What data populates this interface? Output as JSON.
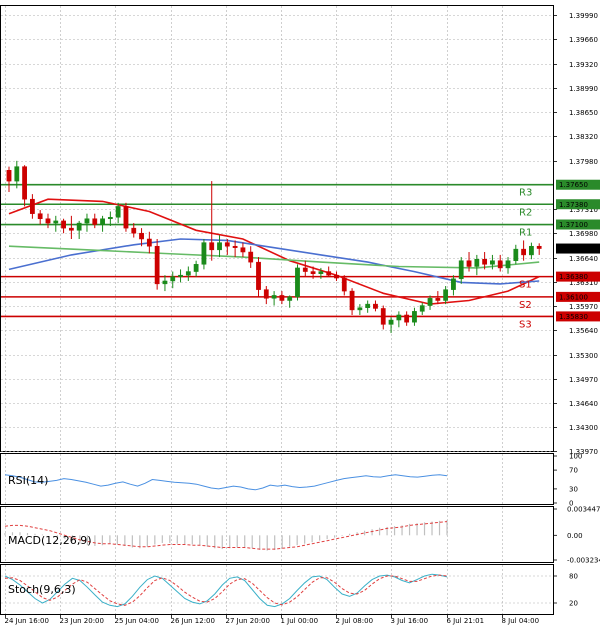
{
  "colors": {
    "up": "#1a8a1a",
    "down": "#cc0000",
    "ma_fast": "#e01010",
    "ma_mid": "#4a6fd0",
    "ma_slow": "#66bb66",
    "resistance": "#2a8a2a",
    "support": "#cc0000",
    "grid": "#b0b0b0",
    "rsi_line": "#4a90e2",
    "macd_hist": "#c0c0c0",
    "macd_signal": "#e04040",
    "stoch_main": "#3ab0c8",
    "stoch_signal": "#e04040"
  },
  "chart_data": [
    {
      "type": "candlestick",
      "x_labels": [
        "24 Jun 16:00",
        "23 Jun 20:00",
        "25 Jun 04:00",
        "26 Jun 12:00",
        "27 Jun 20:00",
        "1 Jul 00:00",
        "2 Jul 08:00",
        "3 Jul 16:00",
        "6 Jul 21:01",
        "8 Jul 04:00"
      ],
      "y_ticks": [
        "1.39990",
        "1.39660",
        "1.39320",
        "1.38990",
        "1.38650",
        "1.38320",
        "1.37980",
        "1.37310",
        "1.36980",
        "1.36640",
        "1.36310",
        "1.35970",
        "1.35640",
        "1.35300",
        "1.34970",
        "1.34640",
        "1.34300",
        "1.33970"
      ],
      "ylim": [
        1.3397,
        1.4012
      ],
      "candles": [
        [
          1.3785,
          1.379,
          1.3755,
          1.377
        ],
        [
          1.377,
          1.3798,
          1.376,
          1.379
        ],
        [
          1.379,
          1.3792,
          1.3735,
          1.3745
        ],
        [
          1.3745,
          1.3752,
          1.3718,
          1.3725
        ],
        [
          1.3725,
          1.373,
          1.371,
          1.3718
        ],
        [
          1.3718,
          1.3725,
          1.3705,
          1.3712
        ],
        [
          1.3712,
          1.3722,
          1.37,
          1.3715
        ],
        [
          1.3715,
          1.3718,
          1.3698,
          1.3705
        ],
        [
          1.3705,
          1.3722,
          1.369,
          1.3702
        ],
        [
          1.3702,
          1.3715,
          1.369,
          1.3712
        ],
        [
          1.3712,
          1.3725,
          1.37,
          1.3718
        ],
        [
          1.3718,
          1.3725,
          1.3705,
          1.371
        ],
        [
          1.371,
          1.3722,
          1.37,
          1.3718
        ],
        [
          1.3718,
          1.3728,
          1.3708,
          1.372
        ],
        [
          1.372,
          1.374,
          1.3712,
          1.3735
        ],
        [
          1.3735,
          1.374,
          1.37,
          1.3705
        ],
        [
          1.3705,
          1.3712,
          1.3692,
          1.3698
        ],
        [
          1.3698,
          1.3705,
          1.368,
          1.369
        ],
        [
          1.369,
          1.37,
          1.367,
          1.368
        ],
        [
          1.368,
          1.369,
          1.362,
          1.3628
        ],
        [
          1.3628,
          1.364,
          1.3618,
          1.3632
        ],
        [
          1.3632,
          1.3645,
          1.3622,
          1.3638
        ],
        [
          1.3638,
          1.3648,
          1.363,
          1.364
        ],
        [
          1.364,
          1.3652,
          1.3632,
          1.3645
        ],
        [
          1.3645,
          1.366,
          1.3638,
          1.3655
        ],
        [
          1.3655,
          1.369,
          1.3648,
          1.3685
        ],
        [
          1.3685,
          1.377,
          1.366,
          1.3675
        ],
        [
          1.3675,
          1.3695,
          1.3665,
          1.3685
        ],
        [
          1.3685,
          1.369,
          1.3668,
          1.368
        ],
        [
          1.368,
          1.3688,
          1.3665,
          1.3678
        ],
        [
          1.3678,
          1.3685,
          1.3665,
          1.3672
        ],
        [
          1.3672,
          1.368,
          1.365,
          1.3658
        ],
        [
          1.3658,
          1.3665,
          1.361,
          1.362
        ],
        [
          1.362,
          1.3625,
          1.36,
          1.3608
        ],
        [
          1.3608,
          1.3618,
          1.3598,
          1.3612
        ],
        [
          1.3612,
          1.3618,
          1.36,
          1.3605
        ],
        [
          1.3605,
          1.3612,
          1.3595,
          1.361
        ],
        [
          1.361,
          1.3655,
          1.3605,
          1.365
        ],
        [
          1.365,
          1.366,
          1.3638,
          1.3645
        ],
        [
          1.3645,
          1.3652,
          1.3635,
          1.3642
        ],
        [
          1.3642,
          1.365,
          1.3635,
          1.3645
        ],
        [
          1.3645,
          1.3652,
          1.3638,
          1.364
        ],
        [
          1.364,
          1.3645,
          1.3632,
          1.3636
        ],
        [
          1.3636,
          1.364,
          1.3612,
          1.3618
        ],
        [
          1.3618,
          1.3622,
          1.3585,
          1.3592
        ],
        [
          1.3592,
          1.36,
          1.3585,
          1.3595
        ],
        [
          1.3595,
          1.3605,
          1.3588,
          1.36
        ],
        [
          1.36,
          1.3605,
          1.359,
          1.3594
        ],
        [
          1.3594,
          1.3598,
          1.3565,
          1.3572
        ],
        [
          1.3572,
          1.3582,
          1.356,
          1.3578
        ],
        [
          1.3578,
          1.359,
          1.3568,
          1.3585
        ],
        [
          1.3585,
          1.359,
          1.357,
          1.3575
        ],
        [
          1.3575,
          1.3595,
          1.357,
          1.359
        ],
        [
          1.359,
          1.3602,
          1.3585,
          1.3598
        ],
        [
          1.3598,
          1.3612,
          1.3592,
          1.3608
        ],
        [
          1.3608,
          1.3618,
          1.36,
          1.3605
        ],
        [
          1.3605,
          1.3625,
          1.36,
          1.362
        ],
        [
          1.362,
          1.364,
          1.3612,
          1.3635
        ],
        [
          1.3635,
          1.3665,
          1.3628,
          1.366
        ],
        [
          1.366,
          1.3672,
          1.3645,
          1.3652
        ],
        [
          1.3652,
          1.3668,
          1.364,
          1.3662
        ],
        [
          1.3662,
          1.3672,
          1.3648,
          1.3655
        ],
        [
          1.3655,
          1.3668,
          1.3648,
          1.366
        ],
        [
          1.366,
          1.3668,
          1.3645,
          1.365
        ],
        [
          1.365,
          1.3665,
          1.3642,
          1.366
        ],
        [
          1.366,
          1.3682,
          1.3655,
          1.3676
        ],
        [
          1.3676,
          1.3688,
          1.366,
          1.3668
        ],
        [
          1.3668,
          1.3685,
          1.3662,
          1.368
        ],
        [
          1.368,
          1.3684,
          1.3668,
          1.36768
        ]
      ],
      "moving_averages": [
        {
          "values": [
            [
              0,
              1.3725
            ],
            [
              5,
              1.3745
            ],
            [
              12,
              1.3742
            ],
            [
              18,
              1.3728
            ],
            [
              24,
              1.3702
            ],
            [
              30,
              1.369
            ],
            [
              36,
              1.366
            ],
            [
              42,
              1.364
            ],
            [
              48,
              1.3615
            ],
            [
              54,
              1.36
            ],
            [
              59,
              1.3605
            ],
            [
              64,
              1.3618
            ],
            [
              68,
              1.3638
            ]
          ]
        },
        {
          "values": [
            [
              0,
              1.3648
            ],
            [
              8,
              1.3668
            ],
            [
              16,
              1.3682
            ],
            [
              22,
              1.369
            ],
            [
              28,
              1.3688
            ],
            [
              34,
              1.3678
            ],
            [
              40,
              1.3668
            ],
            [
              46,
              1.3658
            ],
            [
              52,
              1.3645
            ],
            [
              58,
              1.363
            ],
            [
              63,
              1.3628
            ],
            [
              68,
              1.3632
            ]
          ]
        },
        {
          "values": [
            [
              0,
              1.368
            ],
            [
              10,
              1.3675
            ],
            [
              20,
              1.367
            ],
            [
              30,
              1.3665
            ],
            [
              40,
              1.3658
            ],
            [
              50,
              1.3652
            ],
            [
              60,
              1.365
            ],
            [
              68,
              1.3658
            ]
          ]
        }
      ],
      "levels": [
        {
          "name": "R3",
          "price": "1.37650",
          "value": 1.3765,
          "kind": "resistance"
        },
        {
          "name": "R2",
          "price": "1.37380",
          "value": 1.3738,
          "kind": "resistance"
        },
        {
          "name": "R1",
          "price": "1.37100",
          "value": 1.371,
          "kind": "resistance"
        },
        {
          "name": "S1",
          "price": "1.36380",
          "value": 1.3638,
          "kind": "support"
        },
        {
          "name": "S2",
          "price": "1.36100",
          "value": 1.361,
          "kind": "support"
        },
        {
          "name": "S3",
          "price": "1.35830",
          "value": 1.3583,
          "kind": "support"
        }
      ],
      "current_price": {
        "label": "1.36768",
        "value": 1.36768
      }
    },
    {
      "type": "line",
      "label": "RSI(14)",
      "y_ticks": [
        "100",
        "70",
        "30",
        "0"
      ],
      "ylim": [
        0,
        100
      ],
      "values": [
        60,
        58,
        55,
        50,
        45,
        44,
        46,
        48,
        52,
        50,
        47,
        44,
        40,
        36,
        38,
        42,
        45,
        40,
        36,
        42,
        50,
        48,
        46,
        44,
        43,
        42,
        40,
        36,
        32,
        30,
        33,
        36,
        34,
        30,
        28,
        32,
        38,
        36,
        38,
        35,
        33,
        34,
        36,
        40,
        44,
        48,
        52,
        54,
        56,
        58,
        56,
        55,
        58,
        60,
        58,
        56,
        55,
        57,
        59,
        60,
        58
      ]
    },
    {
      "type": "bar",
      "label": "MACD(12,26,9)",
      "y_ticks": [
        "0.003447",
        "0.00",
        "-0.003234"
      ],
      "ylim": [
        -0.003234,
        0.003447
      ],
      "histogram": [
        0.0003,
        0.0004,
        0.0004,
        0.0003,
        0.0002,
        0.0001,
        0.0,
        -0.0002,
        -0.0005,
        -0.0008,
        -0.0011,
        -0.0013,
        -0.0014,
        -0.0013,
        -0.0011,
        -0.0012,
        -0.0014,
        -0.0016,
        -0.0017,
        -0.0015,
        -0.0012,
        -0.001,
        -0.001,
        -0.0011,
        -0.0012,
        -0.0012,
        -0.0013,
        -0.0015,
        -0.0017,
        -0.0018,
        -0.0017,
        -0.0016,
        -0.0016,
        -0.0017,
        -0.0019,
        -0.002,
        -0.0019,
        -0.0017,
        -0.0015,
        -0.0013,
        -0.0011,
        -0.0009,
        -0.0007,
        -0.0005,
        -0.0003,
        -0.0001,
        0.0002,
        0.0004,
        0.0006,
        0.0008,
        0.001,
        0.0011,
        0.0012,
        0.0013,
        0.0015,
        0.0016,
        0.0017,
        0.0018,
        0.0019,
        0.002
      ],
      "signal": [
        0.0012,
        0.0013,
        0.0013,
        0.0012,
        0.001,
        0.0008,
        0.0006,
        0.0003,
        0.0,
        -0.0003,
        -0.0006,
        -0.0008,
        -0.001,
        -0.0011,
        -0.0011,
        -0.0012,
        -0.0013,
        -0.0014,
        -0.0015,
        -0.0015,
        -0.0014,
        -0.0013,
        -0.0012,
        -0.0012,
        -0.0012,
        -0.0013,
        -0.0013,
        -0.0014,
        -0.0015,
        -0.0016,
        -0.0016,
        -0.0016,
        -0.0016,
        -0.0017,
        -0.0018,
        -0.0018,
        -0.0018,
        -0.0017,
        -0.0016,
        -0.0015,
        -0.0013,
        -0.0011,
        -0.0009,
        -0.0007,
        -0.0005,
        -0.0003,
        -0.0001,
        0.0001,
        0.0003,
        0.0005,
        0.0007,
        0.0009,
        0.001,
        0.0011,
        0.0013,
        0.0014,
        0.0015,
        0.0016,
        0.0017,
        0.0018
      ]
    },
    {
      "type": "line",
      "label": "Stoch(9,6,3)",
      "y_ticks": [
        "80",
        "20"
      ],
      "ylim": [
        0,
        100
      ],
      "main": [
        80,
        72,
        60,
        45,
        30,
        20,
        28,
        45,
        62,
        75,
        70,
        55,
        38,
        22,
        15,
        12,
        18,
        35,
        55,
        72,
        80,
        75,
        60,
        45,
        30,
        22,
        18,
        25,
        40,
        60,
        75,
        78,
        70,
        50,
        30,
        15,
        12,
        18,
        30,
        48,
        65,
        78,
        80,
        72,
        55,
        40,
        35,
        42,
        58,
        72,
        80,
        82,
        78,
        70,
        65,
        72,
        80,
        84,
        82,
        78
      ],
      "signal": [
        75,
        76,
        70,
        58,
        45,
        32,
        26,
        33,
        48,
        62,
        72,
        66,
        52,
        38,
        25,
        18,
        15,
        22,
        36,
        54,
        70,
        76,
        70,
        58,
        44,
        33,
        24,
        22,
        30,
        45,
        62,
        72,
        74,
        64,
        48,
        32,
        20,
        16,
        22,
        34,
        50,
        66,
        76,
        76,
        66,
        52,
        42,
        40,
        48,
        62,
        74,
        80,
        80,
        74,
        68,
        68,
        74,
        80,
        82,
        80
      ]
    }
  ]
}
